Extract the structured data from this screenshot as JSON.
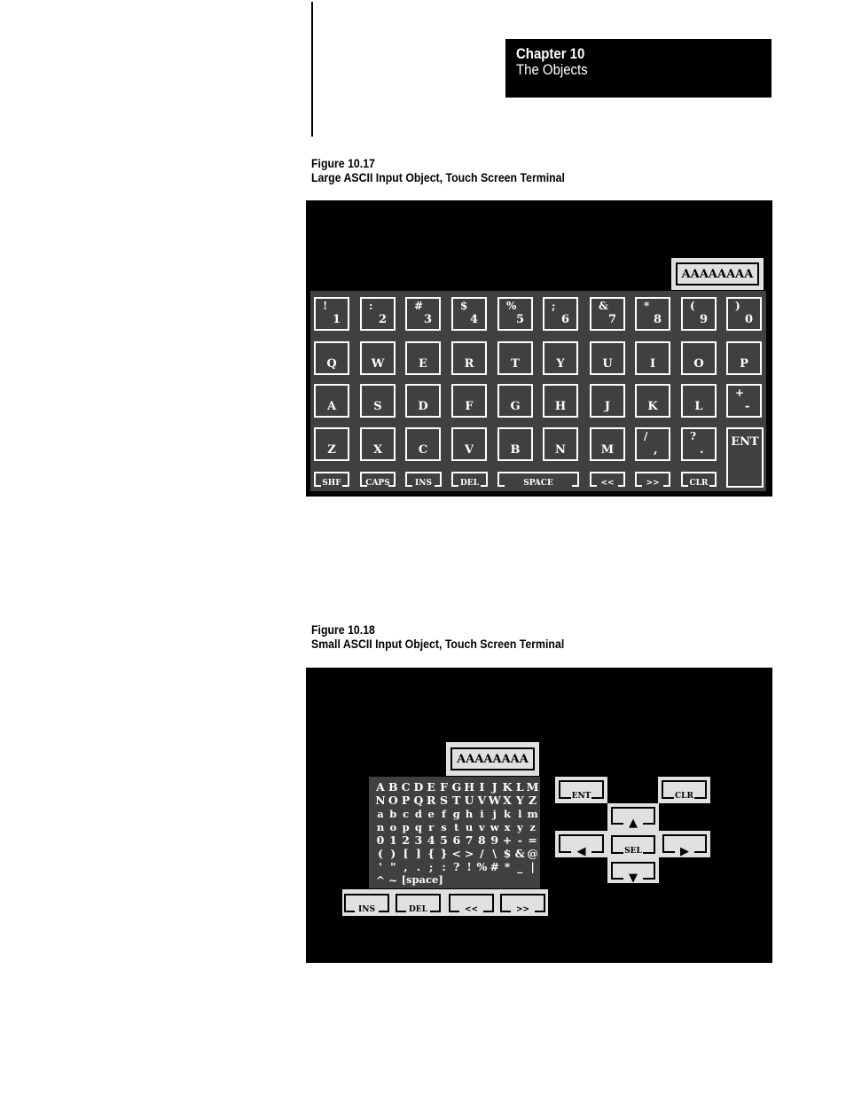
{
  "header": {
    "chapter": "Chapter  10",
    "chapter_title": "The Objects"
  },
  "figure1": {
    "number": "Figure 10.17",
    "title": "Large ASCII Input Object, Touch Screen Terminal",
    "display_value": "AAAAAAAA",
    "rows": [
      [
        {
          "top": "!",
          "bottom": "1"
        },
        {
          "top": ":",
          "bottom": "2"
        },
        {
          "top": "#",
          "bottom": "3"
        },
        {
          "top": "$",
          "bottom": "4"
        },
        {
          "top": "%",
          "bottom": "5"
        },
        {
          "top": ";",
          "bottom": "6"
        },
        {
          "top": "&",
          "bottom": "7"
        },
        {
          "top": "*",
          "bottom": "8"
        },
        {
          "top": "(",
          "bottom": "9"
        },
        {
          "top": ")",
          "bottom": "0"
        }
      ],
      [
        {
          "label": "Q"
        },
        {
          "label": "W"
        },
        {
          "label": "E"
        },
        {
          "label": "R"
        },
        {
          "label": "T"
        },
        {
          "label": "Y"
        },
        {
          "label": "U"
        },
        {
          "label": "I"
        },
        {
          "label": "O"
        },
        {
          "label": "P"
        }
      ],
      [
        {
          "label": "A"
        },
        {
          "label": "S"
        },
        {
          "label": "D"
        },
        {
          "label": "F"
        },
        {
          "label": "G"
        },
        {
          "label": "H"
        },
        {
          "label": "J"
        },
        {
          "label": "K"
        },
        {
          "label": "L"
        },
        {
          "top": "+",
          "bottom": "-"
        }
      ],
      [
        {
          "label": "Z"
        },
        {
          "label": "X"
        },
        {
          "label": "C"
        },
        {
          "label": "V"
        },
        {
          "label": "B"
        },
        {
          "label": "N"
        },
        {
          "label": "M"
        },
        {
          "top": "/",
          "bottom": ","
        },
        {
          "top": "?",
          "bottom": "."
        }
      ]
    ],
    "function_keys": [
      "SHF",
      "CAPS",
      "INS",
      "DEL",
      "SPACE",
      "<<",
      ">>",
      "CLR"
    ],
    "enter_key": "ENT"
  },
  "figure2": {
    "number": "Figure 10.18",
    "title": "Small ASCII Input Object, Touch Screen Terminal",
    "display_value": "AAAAAAAA",
    "char_rows": [
      [
        "A",
        "B",
        "C",
        "D",
        "E",
        "F",
        "G",
        "H",
        "I",
        "J",
        "K",
        "L",
        "M"
      ],
      [
        "N",
        "O",
        "P",
        "Q",
        "R",
        "S",
        "T",
        "U",
        "V",
        "W",
        "X",
        "Y",
        "Z"
      ],
      [
        "a",
        "b",
        "c",
        "d",
        "e",
        "f",
        "g",
        "h",
        "i",
        "j",
        "k",
        "l",
        "m"
      ],
      [
        "n",
        "o",
        "p",
        "q",
        "r",
        "s",
        "t",
        "u",
        "v",
        "w",
        "x",
        "y",
        "z"
      ],
      [
        "0",
        "1",
        "2",
        "3",
        "4",
        "5",
        "6",
        "7",
        "8",
        "9",
        "+",
        "-",
        "="
      ],
      [
        "(",
        ")",
        "[",
        "]",
        "{",
        "}",
        "<",
        ">",
        "/",
        "\\",
        "$",
        "&",
        "@"
      ],
      [
        "'",
        "\"",
        ",",
        ".",
        ";",
        ":",
        "?",
        "!",
        "%",
        "#",
        "*",
        "_",
        "|"
      ],
      [
        "^",
        "~"
      ]
    ],
    "space_label": "[space]",
    "edit_buttons": [
      "INS",
      "DEL",
      "<<",
      ">>"
    ],
    "nav": {
      "enter": "ENT",
      "clear": "CLR",
      "select": "SEL",
      "up": "▲",
      "down": "▼",
      "left": "◀",
      "right": "▶"
    }
  }
}
